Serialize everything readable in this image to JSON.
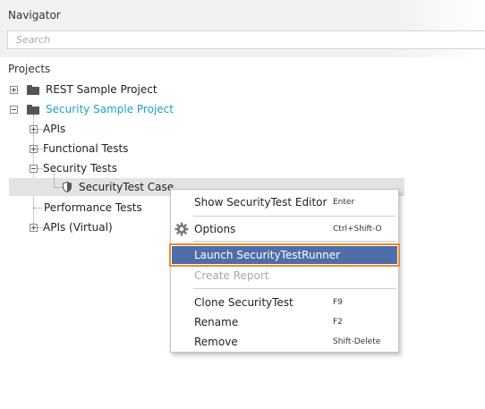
{
  "navigator": {
    "title": "Navigator",
    "search_placeholder": "Search"
  },
  "projects_label": "Projects",
  "tree": {
    "rest_project": "REST Sample Project",
    "security_project": "Security Sample Project",
    "apis": "APIs",
    "functional_tests": "Functional Tests",
    "security_tests": "Security Tests",
    "security_test_case": "SecurityTest Case",
    "performance_tests": "Performance Tests",
    "apis_virtual": "APIs (Virtual)"
  },
  "context_menu": {
    "show_editor": {
      "label": "Show SecurityTest Editor",
      "shortcut": "Enter"
    },
    "options": {
      "label": "Options",
      "shortcut": "Ctrl+Shift-O",
      "icon": "gear-icon"
    },
    "launch_runner": {
      "label": "Launch SecurityTestRunner"
    },
    "create_report": {
      "label": "Create Report"
    },
    "clone": {
      "label": "Clone SecurityTest",
      "shortcut": "F9"
    },
    "rename": {
      "label": "Rename",
      "shortcut": "F2"
    },
    "remove": {
      "label": "Remove",
      "shortcut": "Shift-Delete"
    }
  },
  "colors": {
    "project_link": "#1d9fc4",
    "highlight_bg": "#4f6ea8",
    "highlight_border": "#f0892a"
  }
}
